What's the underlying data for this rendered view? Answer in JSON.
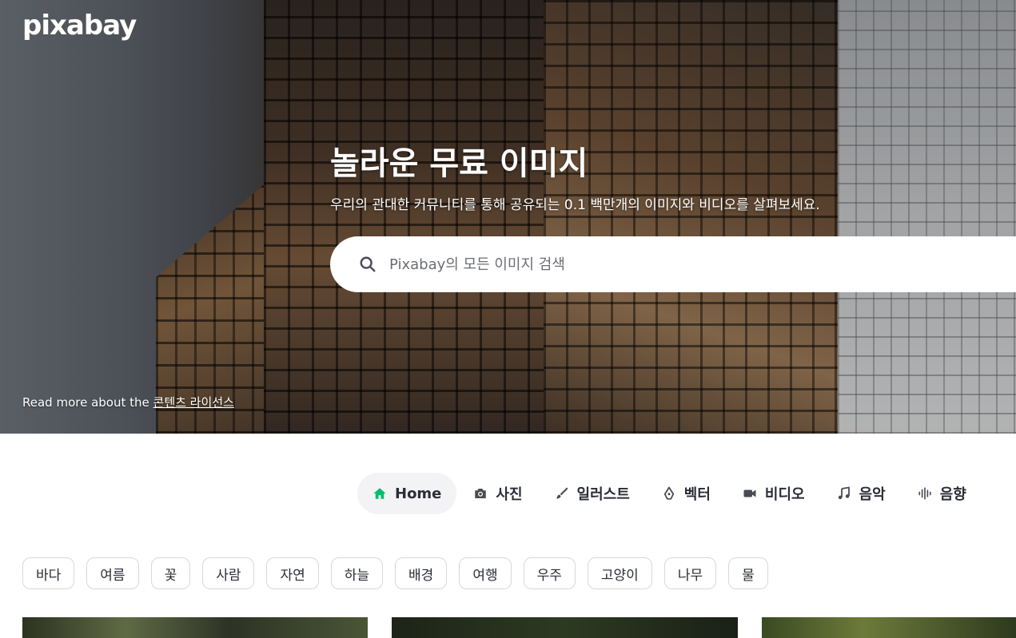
{
  "logo": {
    "text": "pixabay"
  },
  "hero": {
    "title": "놀라운 무료 이미지",
    "subtitle": "우리의 관대한 커뮤니티를 통해 공유되는 0.1 백만개의 이미지와 비디오를 살펴보세요.",
    "search": {
      "placeholder": "Pixabay의 모든 이미지 검색",
      "value": ""
    },
    "license_prefix": "Read more about the ",
    "license_link": "콘텐츠 라이선스"
  },
  "tabs": [
    {
      "label": "Home",
      "icon": "home-icon",
      "active": true
    },
    {
      "label": "사진",
      "icon": "camera-icon",
      "active": false
    },
    {
      "label": "일러스트",
      "icon": "brush-icon",
      "active": false
    },
    {
      "label": "벡터",
      "icon": "pen-nib-icon",
      "active": false
    },
    {
      "label": "비디오",
      "icon": "video-camera-icon",
      "active": false
    },
    {
      "label": "음악",
      "icon": "music-note-icon",
      "active": false
    },
    {
      "label": "음향",
      "icon": "sound-wave-icon",
      "active": false
    }
  ],
  "chips": [
    "바다",
    "여름",
    "꽃",
    "사람",
    "자연",
    "하늘",
    "배경",
    "여행",
    "우주",
    "고양이",
    "나무",
    "물"
  ],
  "colors": {
    "active_tab_icon": "#02be6e",
    "tab_icon": "#4a4c55",
    "chip_border": "#d7d8dc"
  }
}
